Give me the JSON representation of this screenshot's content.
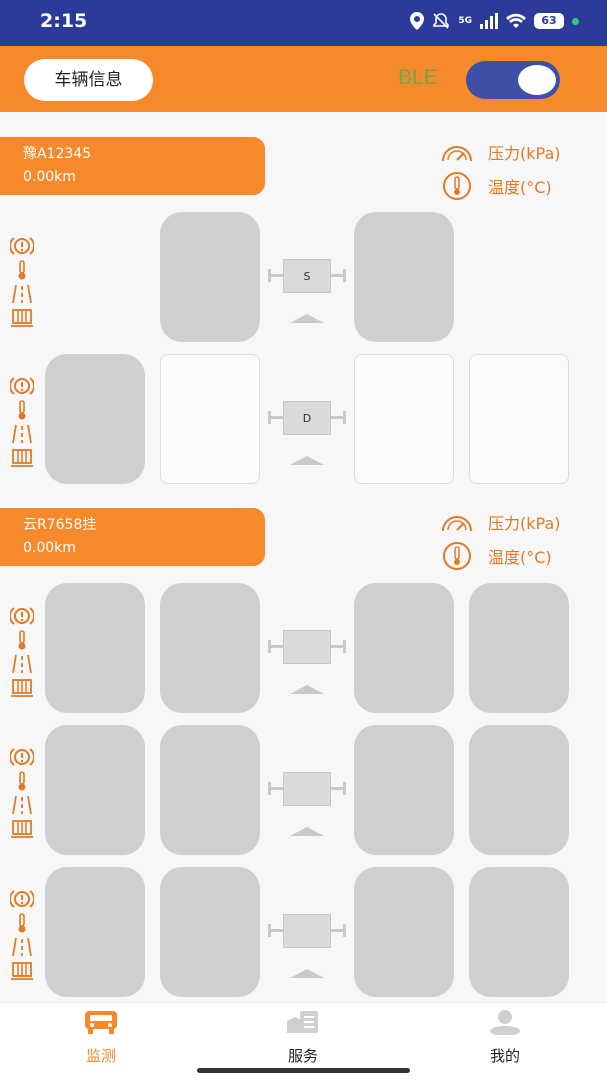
{
  "status_bar": {
    "time": "2:15",
    "network": "5G",
    "battery": "63"
  },
  "header": {
    "vehicle_info_label": "车辆信息",
    "ble_label": "BLE",
    "ble_enabled": true
  },
  "legend": {
    "pressure_label": "压力(kPa)",
    "temperature_label": "温度(°C)"
  },
  "vehicles": [
    {
      "plate": "豫A12345",
      "mileage": "0.00km",
      "axles": [
        {
          "label": "S"
        },
        {
          "label": "D"
        }
      ]
    },
    {
      "plate": "云R7658挂",
      "mileage": "0.00km",
      "axles": [
        {
          "label": ""
        },
        {
          "label": ""
        },
        {
          "label": ""
        }
      ]
    }
  ],
  "nav": {
    "monitor": "监测",
    "service": "服务",
    "mine": "我的"
  },
  "colors": {
    "accent": "#f5892c",
    "status_bar": "#2c3a9a",
    "ble_text": "#6aa84f",
    "toggle": "#3f4fa3"
  }
}
